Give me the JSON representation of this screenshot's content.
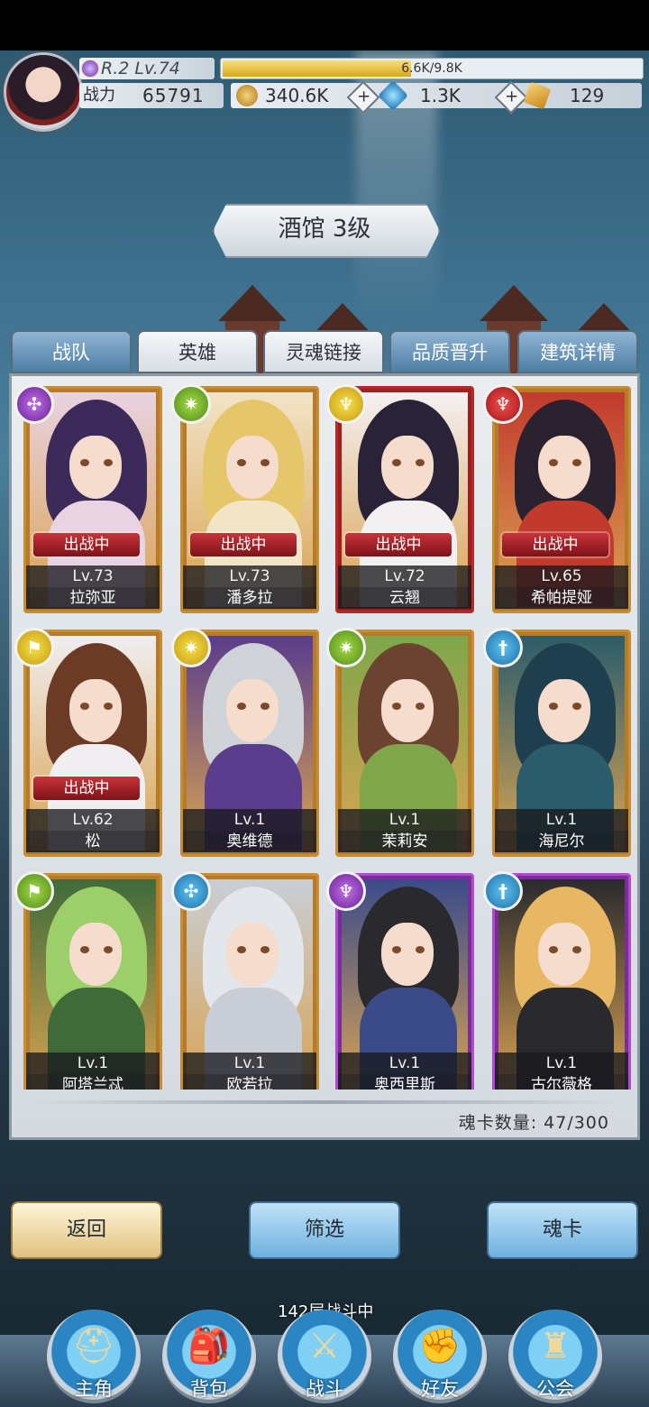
{
  "player": {
    "rank_level": "R.2 Lv.74",
    "exp": "6.6K/9.8K",
    "exp_fraction": 0.67,
    "power_label": "战力",
    "power_value": "65791"
  },
  "resources": {
    "gold": "340.6K",
    "gems": "1.3K",
    "cards": "129"
  },
  "title": "酒馆 3级",
  "tabs": [
    "战队",
    "英雄",
    "灵魂链接",
    "品质晋升",
    "建筑详情"
  ],
  "active_tab": "英雄",
  "cards": [
    {
      "level": "Lv.73",
      "name": "拉弥亚",
      "status": "出战中",
      "element": "purple",
      "element_icon": "magic-staff-icon"
    },
    {
      "level": "Lv.73",
      "name": "潘多拉",
      "status": "出战中",
      "element": "green",
      "element_icon": "shuriken-icon"
    },
    {
      "level": "Lv.72",
      "name": "云翘",
      "status": "出战中",
      "element": "yellow",
      "element_icon": "wings-icon"
    },
    {
      "level": "Lv.65",
      "name": "希帕提娅",
      "status": "出战中",
      "element": "red",
      "element_icon": "wings-icon"
    },
    {
      "level": "Lv.62",
      "name": "松",
      "status": "出战中",
      "element": "yellow",
      "element_icon": "flag-icon"
    },
    {
      "level": "Lv.1",
      "name": "奥维德",
      "status": "",
      "element": "yellow",
      "element_icon": "shuriken-icon"
    },
    {
      "level": "Lv.1",
      "name": "茉莉安",
      "status": "",
      "element": "green",
      "element_icon": "shuriken-icon"
    },
    {
      "level": "Lv.1",
      "name": "海尼尔",
      "status": "",
      "element": "blue",
      "element_icon": "sword-icon"
    },
    {
      "level": "Lv.1",
      "name": "阿塔兰忒",
      "status": "",
      "element": "green",
      "element_icon": "flag-icon"
    },
    {
      "level": "Lv.1",
      "name": "欧若拉",
      "status": "",
      "element": "blue",
      "element_icon": "magic-staff-icon"
    },
    {
      "level": "Lv.1",
      "name": "奥西里斯",
      "status": "",
      "element": "purple",
      "element_icon": "wings-icon"
    },
    {
      "level": "Lv.1",
      "name": "古尔薇格",
      "status": "",
      "element": "blue",
      "element_icon": "sword-icon"
    }
  ],
  "card_count": "魂卡数量: 47/300",
  "buttons": {
    "back": "返回",
    "filter": "筛选",
    "soul_card": "魂卡"
  },
  "battle_status": "142层战斗中",
  "nav": [
    "主角",
    "背包",
    "战斗",
    "好友",
    "公会"
  ]
}
